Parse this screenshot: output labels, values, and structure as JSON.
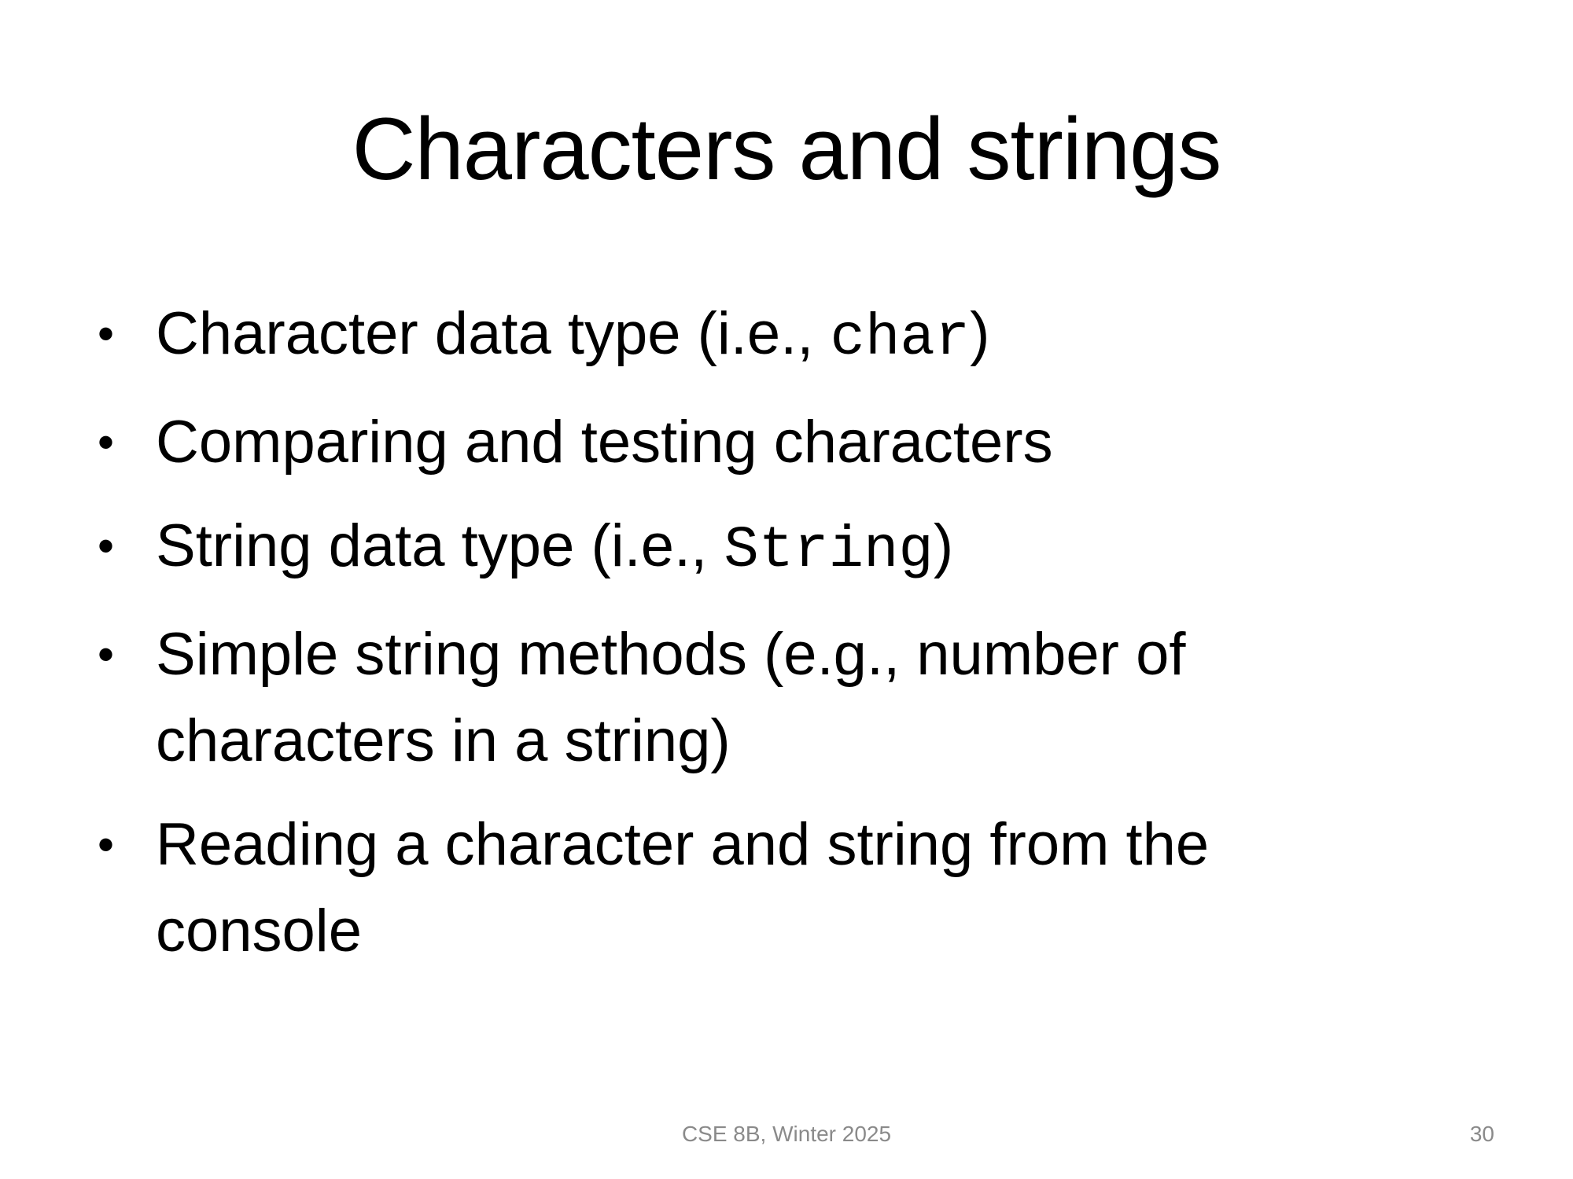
{
  "slide": {
    "title": "Characters and strings",
    "bullets": [
      {
        "text_before": "Character data type (i.e., ",
        "code": "char",
        "text_after": ")"
      },
      {
        "text_before": "Comparing and testing characters",
        "code": "",
        "text_after": ""
      },
      {
        "text_before": "String data type (i.e., ",
        "code": "String",
        "text_after": ")"
      },
      {
        "text_before": "Simple string methods (e.g., number of characters in a string)",
        "code": "",
        "text_after": ""
      },
      {
        "text_before": "Reading a character and string from the console",
        "code": "",
        "text_after": ""
      }
    ],
    "bullet_glyph": "•",
    "footer": "CSE 8B, Winter 2025",
    "page_number": "30"
  }
}
